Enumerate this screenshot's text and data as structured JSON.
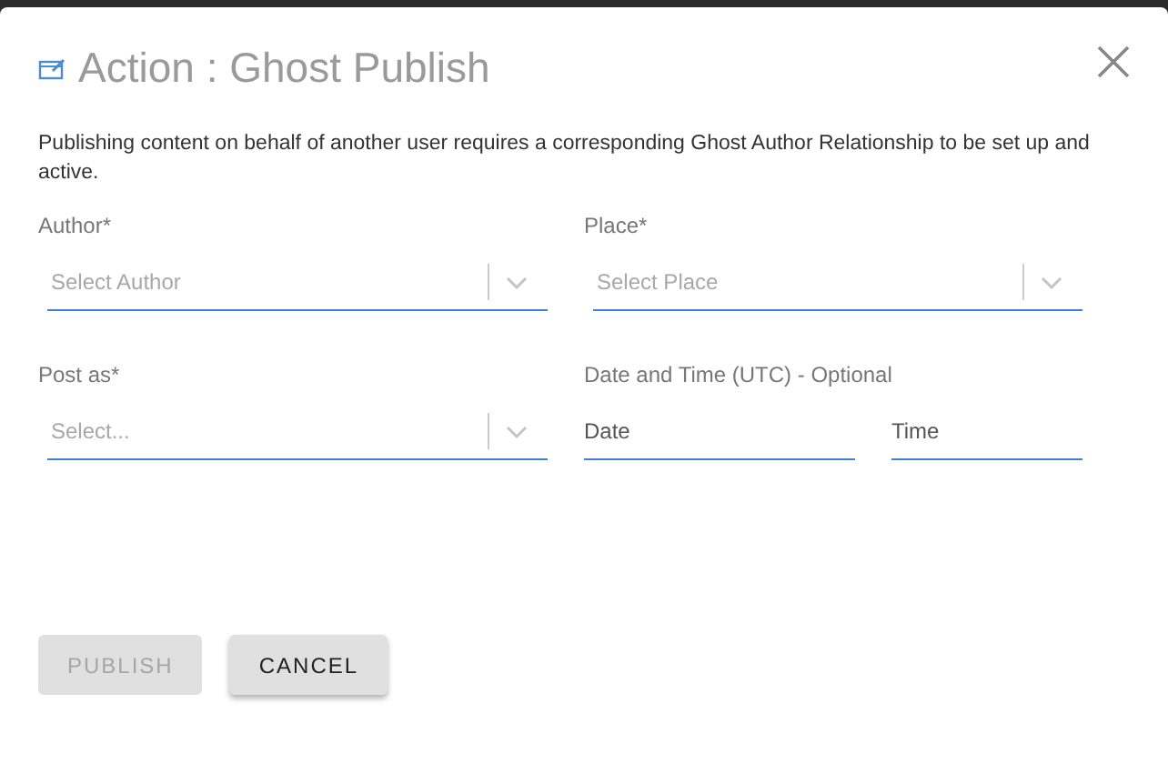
{
  "dialog": {
    "title": "Action : Ghost Publish",
    "description": "Publishing content on behalf of another user requires a corresponding Ghost Author Relationship to be set up and active."
  },
  "fields": [
    {
      "kind": "select",
      "label": "Author*",
      "placeholder": "Select Author"
    },
    {
      "kind": "select",
      "label": "Place*",
      "placeholder": "Select Place"
    },
    {
      "kind": "select",
      "label": "Post as*",
      "placeholder": "Select..."
    },
    {
      "kind": "datetime",
      "label": "Date and Time (UTC) - Optional",
      "date": "Date",
      "time": "Time"
    }
  ],
  "buttons": [
    {
      "label": "PUBLISH",
      "disabled": true
    },
    {
      "label": "CANCEL",
      "disabled": false
    }
  ]
}
